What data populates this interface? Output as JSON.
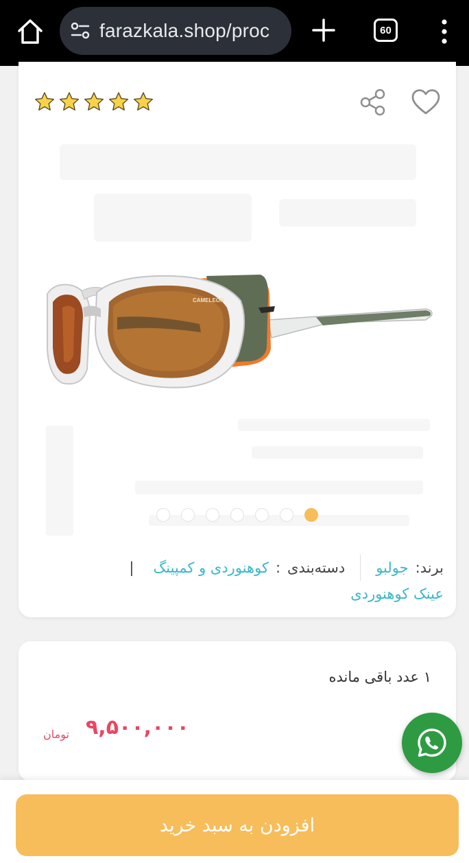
{
  "browser": {
    "url": "farazkala.shop/proc",
    "tab_count": "60"
  },
  "product": {
    "rating_stars": 5,
    "image_count": 7,
    "active_image_index": 0,
    "brand_label": "برند:",
    "brand_value": "جولبو",
    "category_label": "دسته‌بندی",
    "category_colon": ":",
    "category_1": "کوهنوردی و کمپینگ",
    "category_pipe": "|",
    "category_2": "عینک کوهنوردی",
    "lens_text": "CAMELEON"
  },
  "purchase": {
    "stock_text": "۱ عدد باقی مانده",
    "price": "۹,۵۰۰,۰۰۰",
    "currency": "تومان",
    "add_to_cart_label": "افزودن به سبد خرید"
  },
  "colors": {
    "accent": "#f7bd5a",
    "link": "#38b7c9",
    "price": "#e84763",
    "whatsapp": "#2e9b43"
  },
  "icons": [
    "home-icon",
    "site-settings-icon",
    "new-tab-icon",
    "tabs-counter-icon",
    "more-menu-icon",
    "star-icon",
    "share-icon",
    "heart-icon",
    "whatsapp-icon"
  ]
}
